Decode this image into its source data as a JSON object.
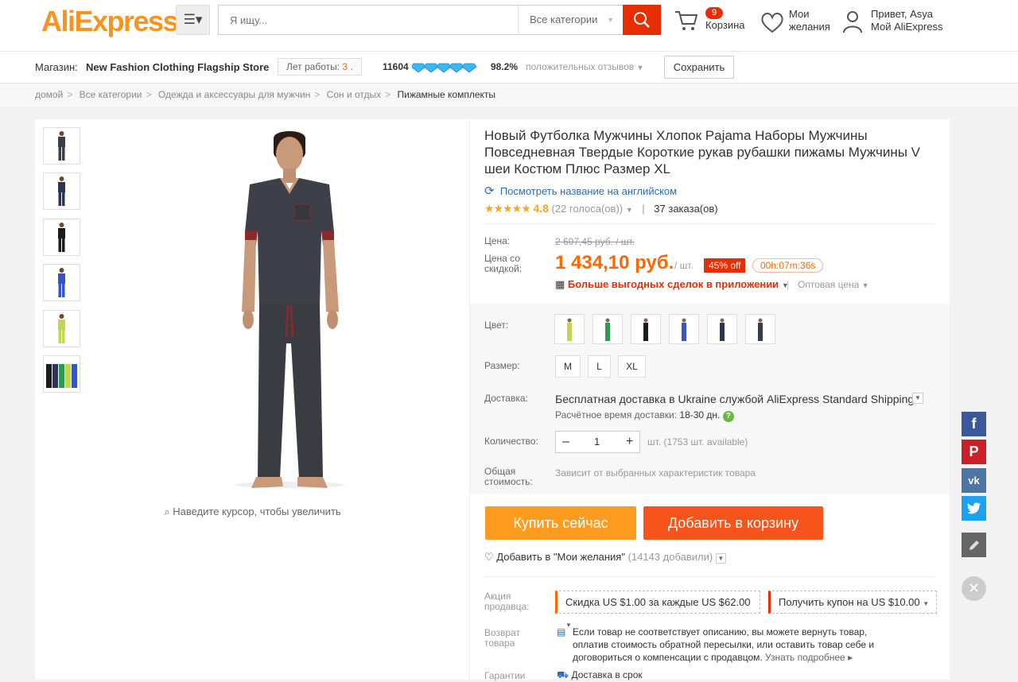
{
  "header": {
    "logo": "AliExpress",
    "logo_tm": "™",
    "search_placeholder": "Я ищу...",
    "category": "Все категории",
    "cart_count": "9",
    "cart_label": "Корзина",
    "wishlist_line1": "Мои",
    "wishlist_line2": "желания",
    "greeting": "Привет, Asya",
    "my_account": "Мой AliExpress"
  },
  "store": {
    "label": "Магазин:",
    "name": "New Fashion Clothing Flagship Store",
    "years_label": "Лет работы:",
    "years_value": "3",
    "score": "11604",
    "feedback_pct": "98.2%",
    "feedback_label": "положительных отзывов",
    "save_label": "Сохранить"
  },
  "breadcrumb": [
    "домой",
    "Все категории",
    "Одежда и аксессуары для мужчин",
    "Сон и отдых",
    "Пижамные комплекты"
  ],
  "gallery": {
    "hint": "Наведите курсор, чтобы увеличить",
    "thumb_colors": [
      "#3b3d45",
      "#2e3554",
      "#1c1c1c",
      "#3555c8",
      "#c3d654",
      "#2d9a4f"
    ]
  },
  "product": {
    "title": "Новый Футболка Мужчины Хлопок Pajama Наборы Мужчины Повседневная Твердые Короткие рукав рубашки пижамы Мужчины V шеи Костюм Плюс Размер XL",
    "translate_link": "Посмотреть название на английском",
    "stars": "★★★★★",
    "rating": "4.8",
    "votes": "(22 голоса(ов))",
    "orders": "37 заказа(ов)"
  },
  "price": {
    "label": "Цена:",
    "old": "2 607,45 руб. / шт.",
    "discount_label_1": "Цена со",
    "discount_label_2": "скидкой:",
    "current": "1 434,10 руб.",
    "unit": "/ шт.",
    "discount_badge": "45% off",
    "timer": "00h:07m:36s",
    "app_deals": "Больше выгодных сделок в приложении",
    "wholesale": "Оптовая цена"
  },
  "options": {
    "color_label": "Цвет:",
    "color_swatches": [
      "#c3d654",
      "#2d9a4f",
      "#1c1c1c",
      "#3555c8",
      "#2e3554",
      "#3b3d45"
    ],
    "size_label": "Размер:",
    "sizes": [
      "M",
      "L",
      "XL"
    ],
    "shipping_label": "Доставка:",
    "shipping_prefix": "Бесплатная доставка в",
    "shipping_country": "Ukraine",
    "shipping_service": "службой AliExpress Standard Shipping",
    "delivery_time_label": "Расчётное время доставки:",
    "delivery_time": "18-30 дн.",
    "quantity_label": "Количество:",
    "quantity": "1",
    "quantity_unit": "шт. (1753 шт. available)",
    "total_label_1": "Общая",
    "total_label_2": "стоимость:",
    "total_value": "Зависит от выбранных характеристик товара"
  },
  "actions": {
    "buy_now": "Купить сейчас",
    "add_to_cart": "Добавить в корзину",
    "wishlist_add": "Добавить в \"Мои желания\"",
    "wishlist_count": "(14143 добавили)"
  },
  "promo": {
    "label_1": "Акция",
    "label_2": "продавца:",
    "coupon1_pre": "Скидка",
    "coupon1_amt": "US $1.00",
    "coupon1_mid": "за каждые",
    "coupon1_amt2": "US $62.00",
    "coupon2_pre": "Получить купон на",
    "coupon2_amt": "US $10.00"
  },
  "returns": {
    "label_1": "Возврат",
    "label_2": "товара",
    "line1": "Если товар не соответствует описанию, вы можете вернуть товар,",
    "line2": "оплатив стоимость обратной пересылки, или оставить товар себе и",
    "line3": "договориться о компенсации с продавцом.",
    "more": "Узнать подробнее"
  },
  "guarantee": {
    "label": "Гарантии",
    "value": "Доставка в срок"
  },
  "social": {
    "colors": [
      "#3b5998",
      "#cb2027",
      "#4c75a3",
      "#1da1f2",
      "#666666",
      "#cccccc"
    ],
    "fb": "f",
    "pin": "P",
    "vk": "vk"
  }
}
